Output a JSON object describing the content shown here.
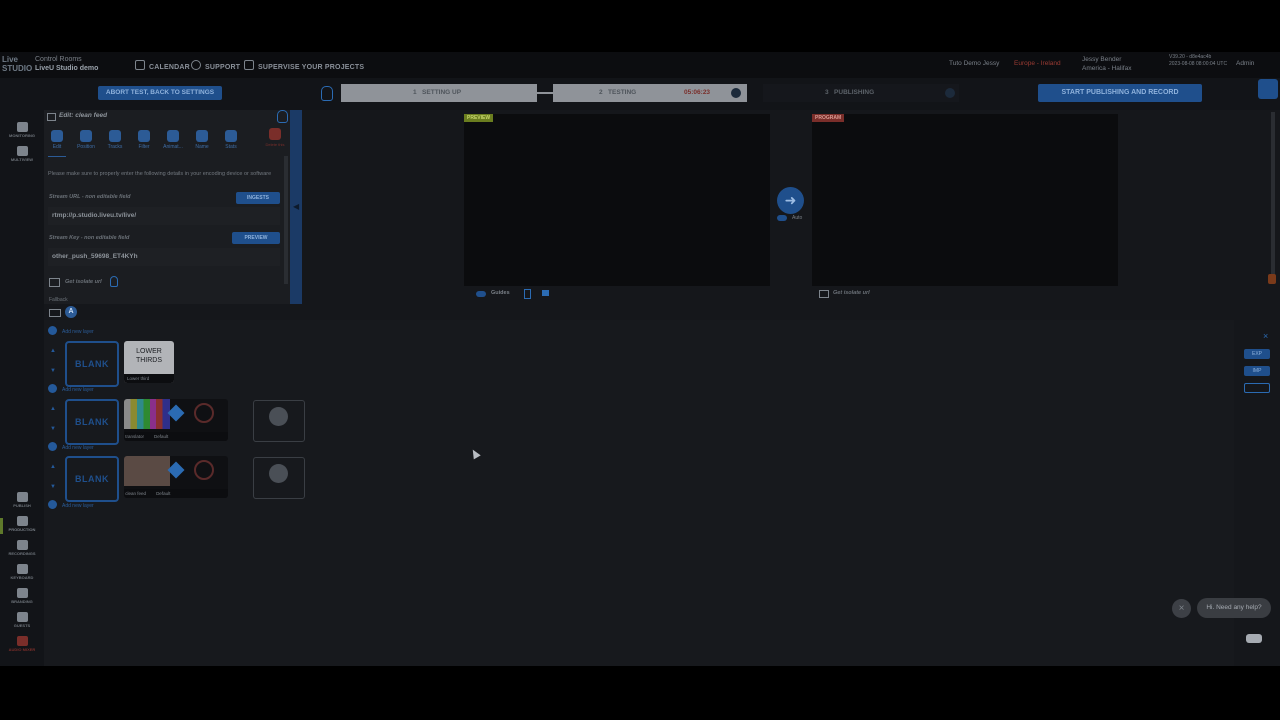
{
  "topbar": {
    "logo": "Live STUDIO",
    "control_rooms": "Control Rooms",
    "studio_name": "LiveU Studio demo",
    "nav": [
      {
        "label": "CALENDAR",
        "icon": "calendar-icon"
      },
      {
        "label": "SUPPORT",
        "icon": "support-icon"
      },
      {
        "label": "SUPERVISE YOUR PROJECTS",
        "icon": "projects-icon"
      }
    ],
    "user_project": "Tuto Demo Jessy",
    "region": "Europe - Ireland",
    "user_name": "Jessy Bender",
    "user_location": "America - Halifax",
    "version": "V39.20 - d8e4ac4b",
    "version_detail": "2023-08-08 08:00:04 UTC",
    "admin": "Admin"
  },
  "steps": {
    "abort": "ABORT TEST, BACK TO SETTINGS",
    "items": [
      {
        "num": "1",
        "label": "SETTING UP"
      },
      {
        "num": "2",
        "label": "TESTING",
        "timer": "05:06:23"
      },
      {
        "num": "3",
        "label": "PUBLISHING"
      }
    ],
    "start": "START PUBLISHING AND RECORD"
  },
  "rail": [
    {
      "label": "MONITORING",
      "icon": "monitor-icon"
    },
    {
      "label": "MULTIVIEW",
      "icon": "multiview-icon"
    },
    {
      "label": "PUBLISH",
      "icon": "publish-icon"
    },
    {
      "label": "PRODUCTION",
      "icon": "camera-icon"
    },
    {
      "label": "RECORDINGS",
      "icon": "tools-icon"
    },
    {
      "label": "KEYBOARD",
      "icon": "keyboard-icon"
    },
    {
      "label": "BRANDING",
      "icon": "text-icon"
    },
    {
      "label": "GUESTS",
      "icon": "guests-icon"
    },
    {
      "label": "AUDIO MIXER",
      "icon": "audio-icon"
    }
  ],
  "edit": {
    "title": "Edit: clean feed",
    "tools": [
      "Edit",
      "Position",
      "Tracks",
      "Filter",
      "Animat...",
      "Name",
      "Stats"
    ],
    "delete": "Delete this",
    "notice": "Please make sure to properly enter the following details in your encoding device or software",
    "stream_url_label": "Stream URL - non editable field",
    "ingests": "INGESTS",
    "stream_url": "rtmp://p.studio.liveu.tv/live/",
    "stream_key_label": "Stream Key - non editable field",
    "preview_btn": "PREVIEW",
    "stream_key": "other_push_59698_ET4KYh",
    "isolate": "Get isolate url",
    "fallback": "Fallback"
  },
  "monitors": {
    "preview_tag": "PREVIEW",
    "program_tag": "PROGRAM",
    "auto": "Auto",
    "guides": "Guides",
    "program_isolate": "Get isolate url"
  },
  "layers": {
    "add_layer": "Add new layer",
    "blank": "BLANK",
    "lower_thirds_title": "LOWER THIRDS",
    "lower_thirds_caption": "Lower third",
    "rows": [
      {
        "source": "translator",
        "preset": "Default"
      },
      {
        "source": "clean feed",
        "preset": "Default"
      }
    ],
    "right_buttons": [
      "EXP",
      "IMP"
    ]
  },
  "chat": {
    "bubble": "Hi. Need any help?"
  }
}
